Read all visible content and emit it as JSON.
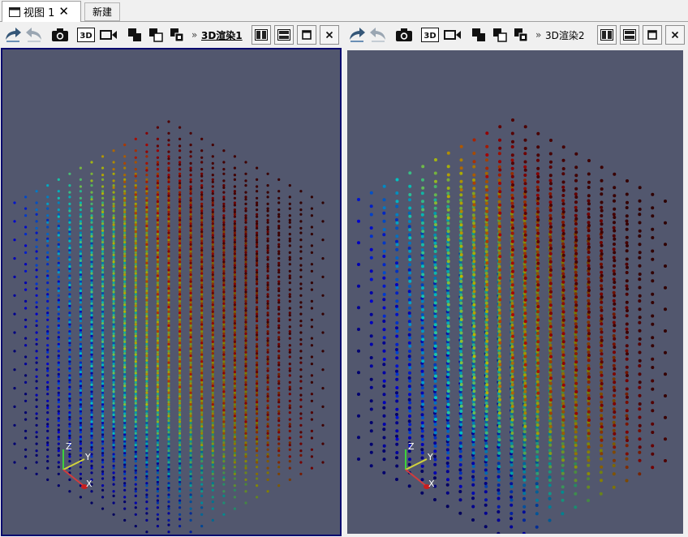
{
  "tabs": [
    {
      "label": "视图 1",
      "active": true
    },
    {
      "label": "新建",
      "active": false
    }
  ],
  "panels": [
    {
      "render_name": "3D渲染1",
      "active": true
    },
    {
      "render_name": "3D渲染2",
      "active": false
    }
  ],
  "toolbar": {
    "chevron": "»"
  },
  "axes": {
    "x": "X",
    "y": "Y",
    "z": "Z"
  },
  "icons": [
    "undo-camera-icon",
    "redo-camera-icon",
    "camera-icon",
    "3d-toggle-icon",
    "record-icon",
    "select-icon",
    "select-points-icon",
    "interactive-select-icon",
    "split-horizontal-icon",
    "split-vertical-icon",
    "maximize-icon",
    "close-icon"
  ],
  "colors": {
    "view_background": "#52576e",
    "active_frame": "#0a0a6e"
  }
}
